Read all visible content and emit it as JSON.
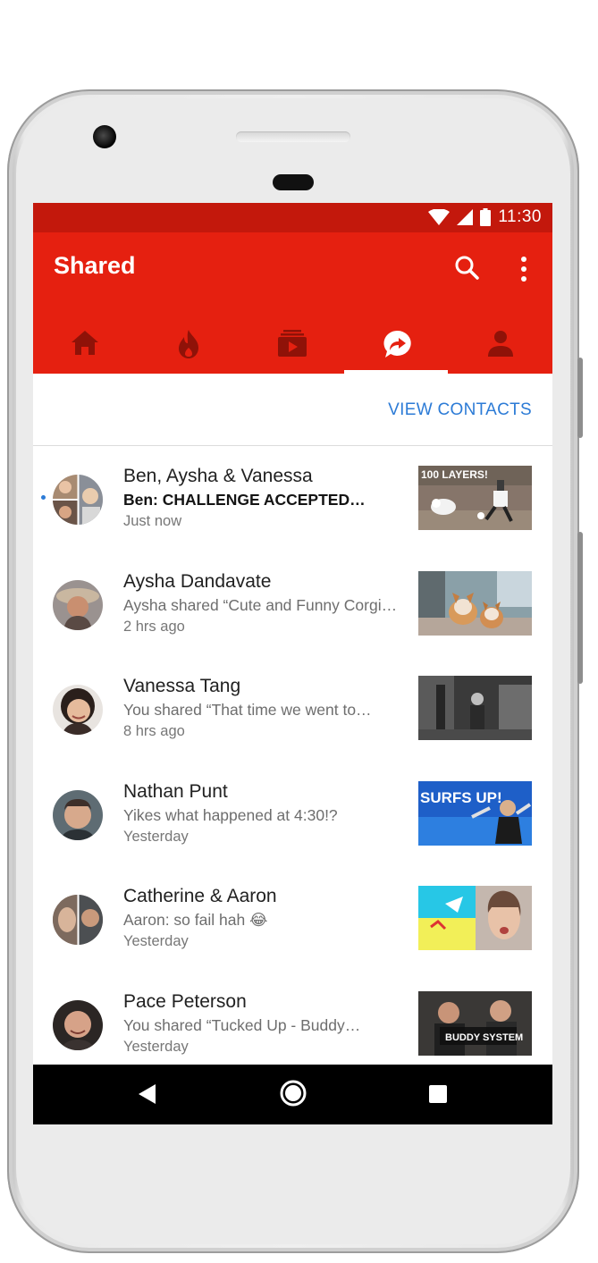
{
  "status_bar": {
    "time": "11:30"
  },
  "app_bar": {
    "title": "Shared",
    "search_icon": "search-icon",
    "menu_icon": "more-vert-icon",
    "tabs": [
      {
        "icon": "home-icon"
      },
      {
        "icon": "trending-icon"
      },
      {
        "icon": "subscriptions-icon"
      },
      {
        "icon": "shared-icon",
        "selected": true
      },
      {
        "icon": "account-icon"
      }
    ]
  },
  "contacts": {
    "label": "VIEW CONTACTS"
  },
  "conversations": [
    {
      "name": "Ben, Aysha & Vanessa",
      "message": "Ben: CHALLENGE ACCEPTED…",
      "time": "Just now",
      "unread": true,
      "thumbnail_text": "100 LAYERS!"
    },
    {
      "name": "Aysha Dandavate",
      "message": "Aysha shared “Cute and Funny Corgi…",
      "time": "2 hrs ago"
    },
    {
      "name": "Vanessa Tang",
      "message": "You shared “That time we went to…",
      "time": "8 hrs ago"
    },
    {
      "name": "Nathan Punt",
      "message": "Yikes what happened at 4:30!?",
      "time": "Yesterday",
      "thumbnail_text": "SURFS UP!"
    },
    {
      "name": "Catherine & Aaron",
      "message": "Aaron: so fail hah 😂",
      "time": "Yesterday"
    },
    {
      "name": "Pace Peterson",
      "message": "You shared “Tucked Up - Buddy…",
      "time": "Yesterday",
      "thumbnail_text": "BUDDY SYSTEM"
    }
  ],
  "nav_bar": {
    "back_icon": "back-icon",
    "home_icon": "home-circle-icon",
    "recents_icon": "recents-icon"
  },
  "colors": {
    "status_bar": "#c3180c",
    "app_bar": "#e52010",
    "accent": "#2c7bd6"
  }
}
